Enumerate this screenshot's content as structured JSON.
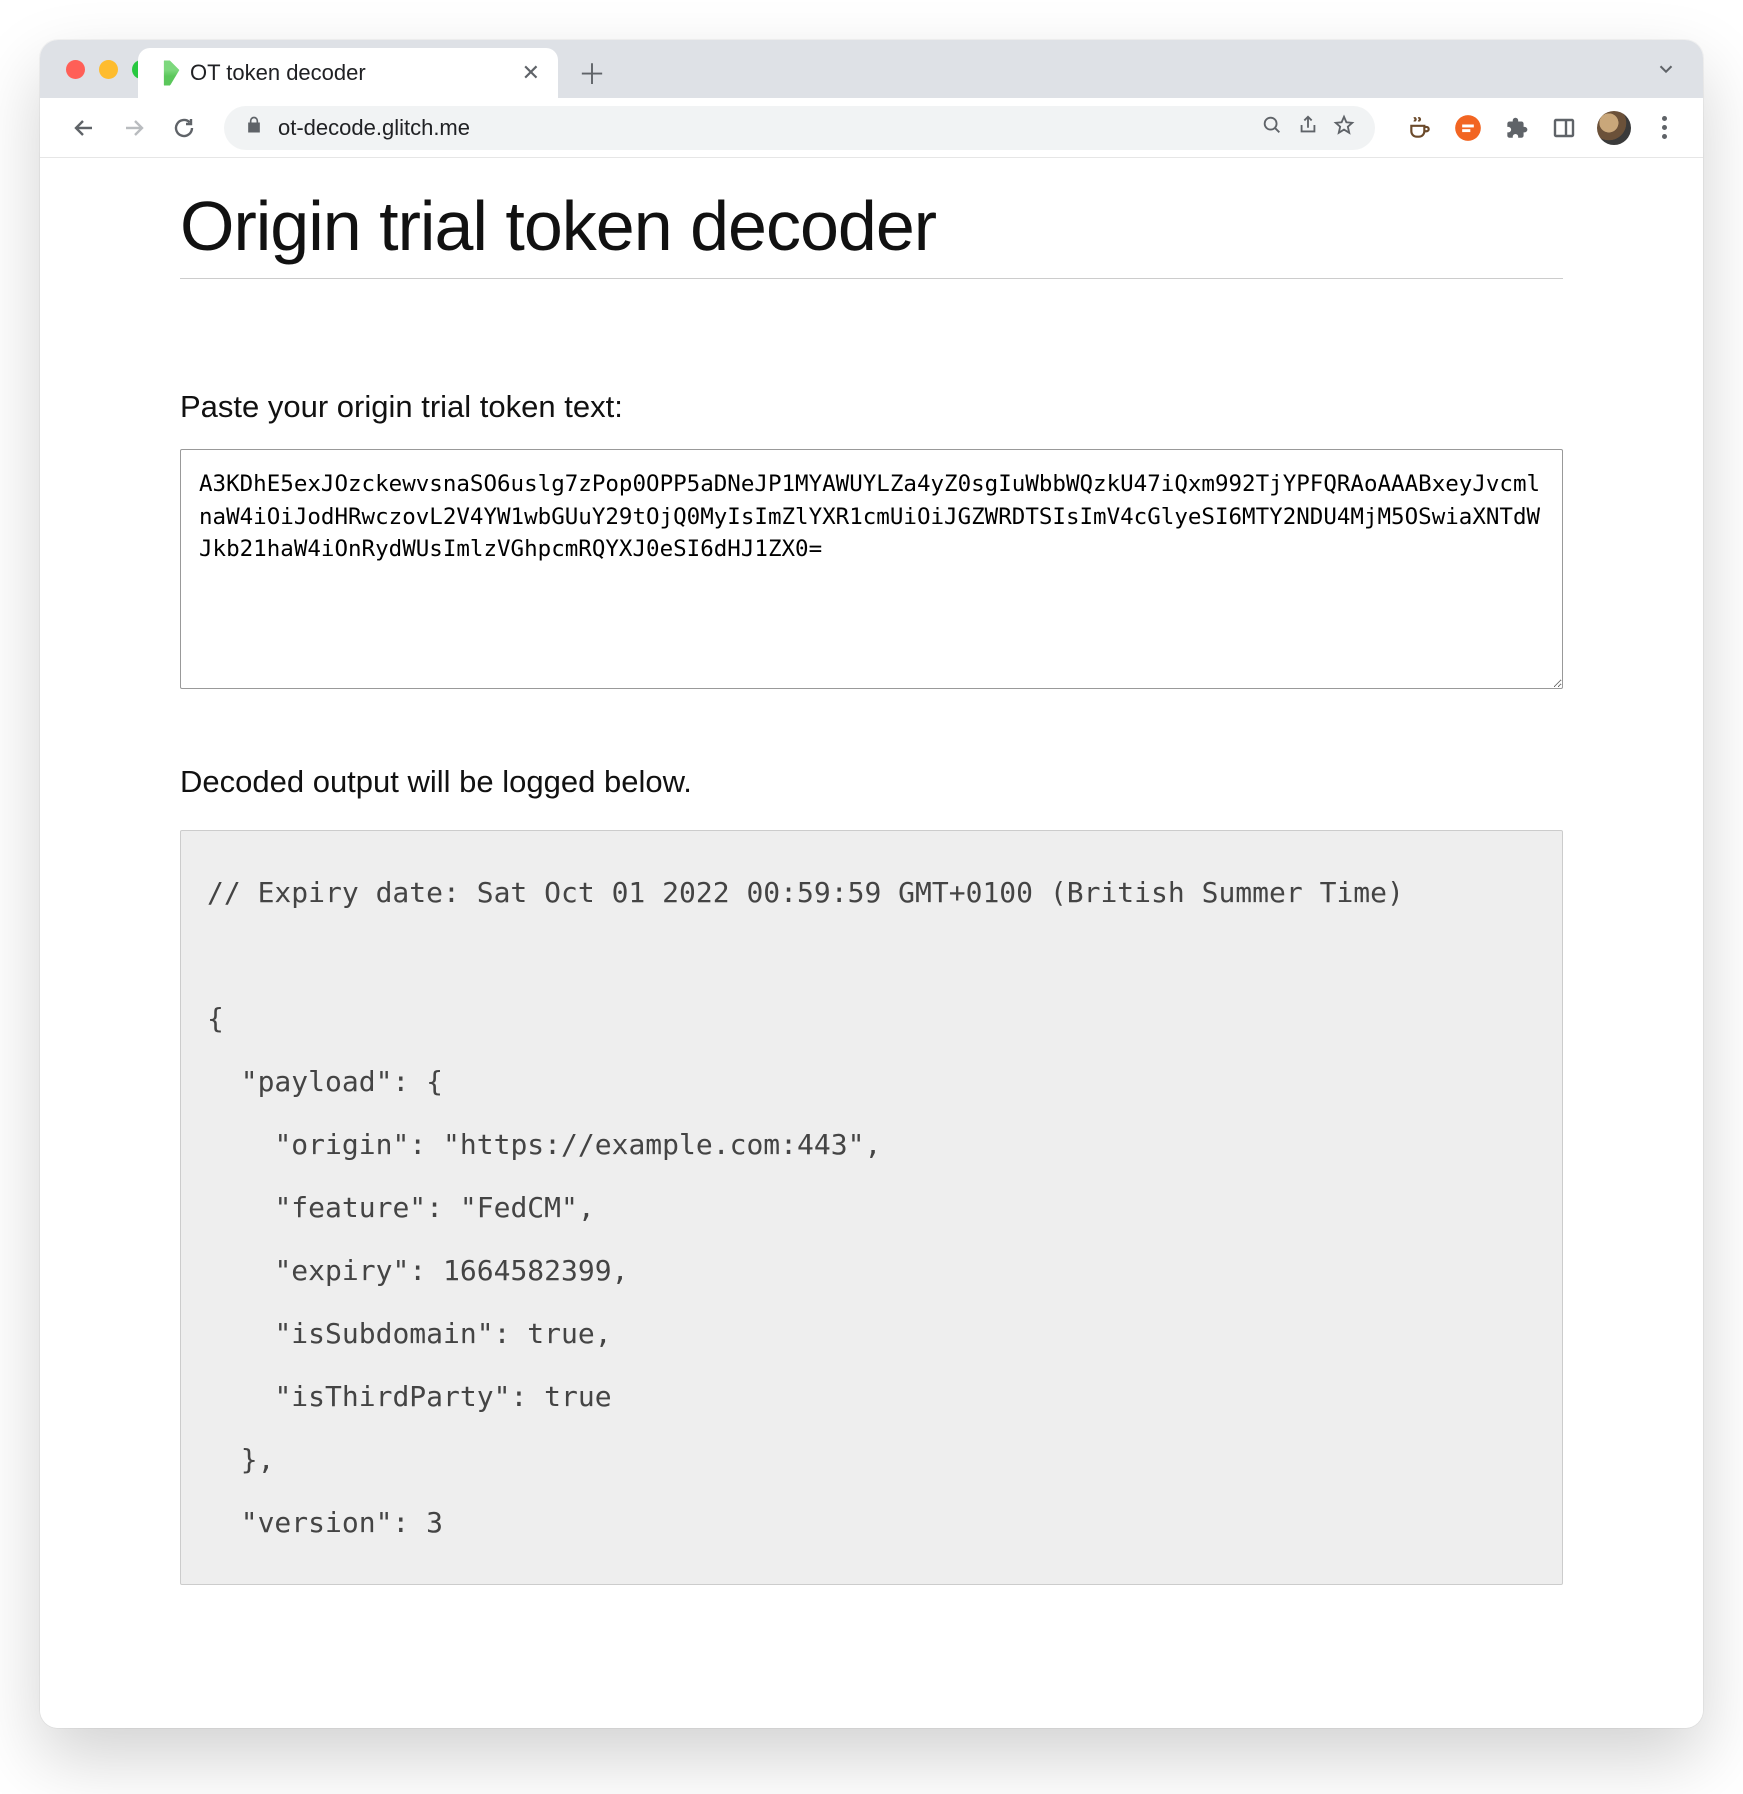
{
  "browser": {
    "tab_title": "OT token decoder",
    "url": "ot-decode.glitch.me"
  },
  "page": {
    "heading": "Origin trial token decoder",
    "paste_label": "Paste your origin trial token text:",
    "token_value": "A3KDhE5exJOzckewvsnaSO6uslg7zPop0OPP5aDNeJP1MYAWUYLZa4yZ0sgIuWbbWQzkU47iQxm992TjYPFQRAoAAABxeyJvcmlnaW4iOiJodHRwczovL2V4YW1wbGUuY29tOjQ0MyIsImZlYXR1cmUiOiJGZWRDTSIsImV4cGlyeSI6MTY2NDU4MjM5OSwiaXNTdWJkb21haW4iOnRydWUsImlzVGhpcmRQYXJ0eSI6dHJ1ZX0=",
    "output_label": "Decoded output will be logged below.",
    "decoded_text": "// Expiry date: Sat Oct 01 2022 00:59:59 GMT+0100 (British Summer Time)\n\n{\n  \"payload\": {\n    \"origin\": \"https://example.com:443\",\n    \"feature\": \"FedCM\",\n    \"expiry\": 1664582399,\n    \"isSubdomain\": true,\n    \"isThirdParty\": true\n  },\n  \"version\": 3",
    "decoded_structured": {
      "expiry_comment": "Expiry date: Sat Oct 01 2022 00:59:59 GMT+0100 (British Summer Time)",
      "payload": {
        "origin": "https://example.com:443",
        "feature": "FedCM",
        "expiry": 1664582399,
        "isSubdomain": true,
        "isThirdParty": true
      },
      "version": 3
    }
  }
}
